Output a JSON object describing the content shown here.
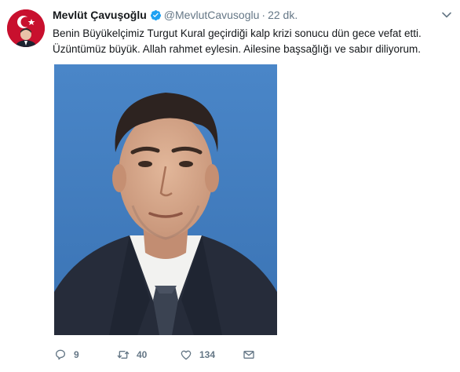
{
  "tweet": {
    "author": {
      "name": "Mevlüt Çavuşoğlu",
      "handle": "@MevlutCavusoglu",
      "verified": true,
      "avatar_icon": "profile-photo-with-flag"
    },
    "separator": "·",
    "time": "22 dk.",
    "text_lines": [
      "Benin Büyükelçimiz Turgut Kural geçirdiği kalp krizi sonucu dün gece vefat etti.",
      "Üzüntümüz büyük. Allah rahmet eylesin. Ailesine başsağlığı ve sabır diliyorum."
    ],
    "media": {
      "kind": "portrait-photo",
      "background_color": "#3f7cc0"
    },
    "actions": {
      "reply": {
        "icon": "reply-icon",
        "count": "9"
      },
      "retweet": {
        "icon": "retweet-icon",
        "count": "40"
      },
      "like": {
        "icon": "heart-icon",
        "count": "134"
      },
      "dm": {
        "icon": "envelope-icon"
      }
    }
  },
  "colors": {
    "text": "#14171a",
    "secondary": "#657786",
    "verified": "#1da1f2",
    "flag_red": "#c8102e"
  }
}
